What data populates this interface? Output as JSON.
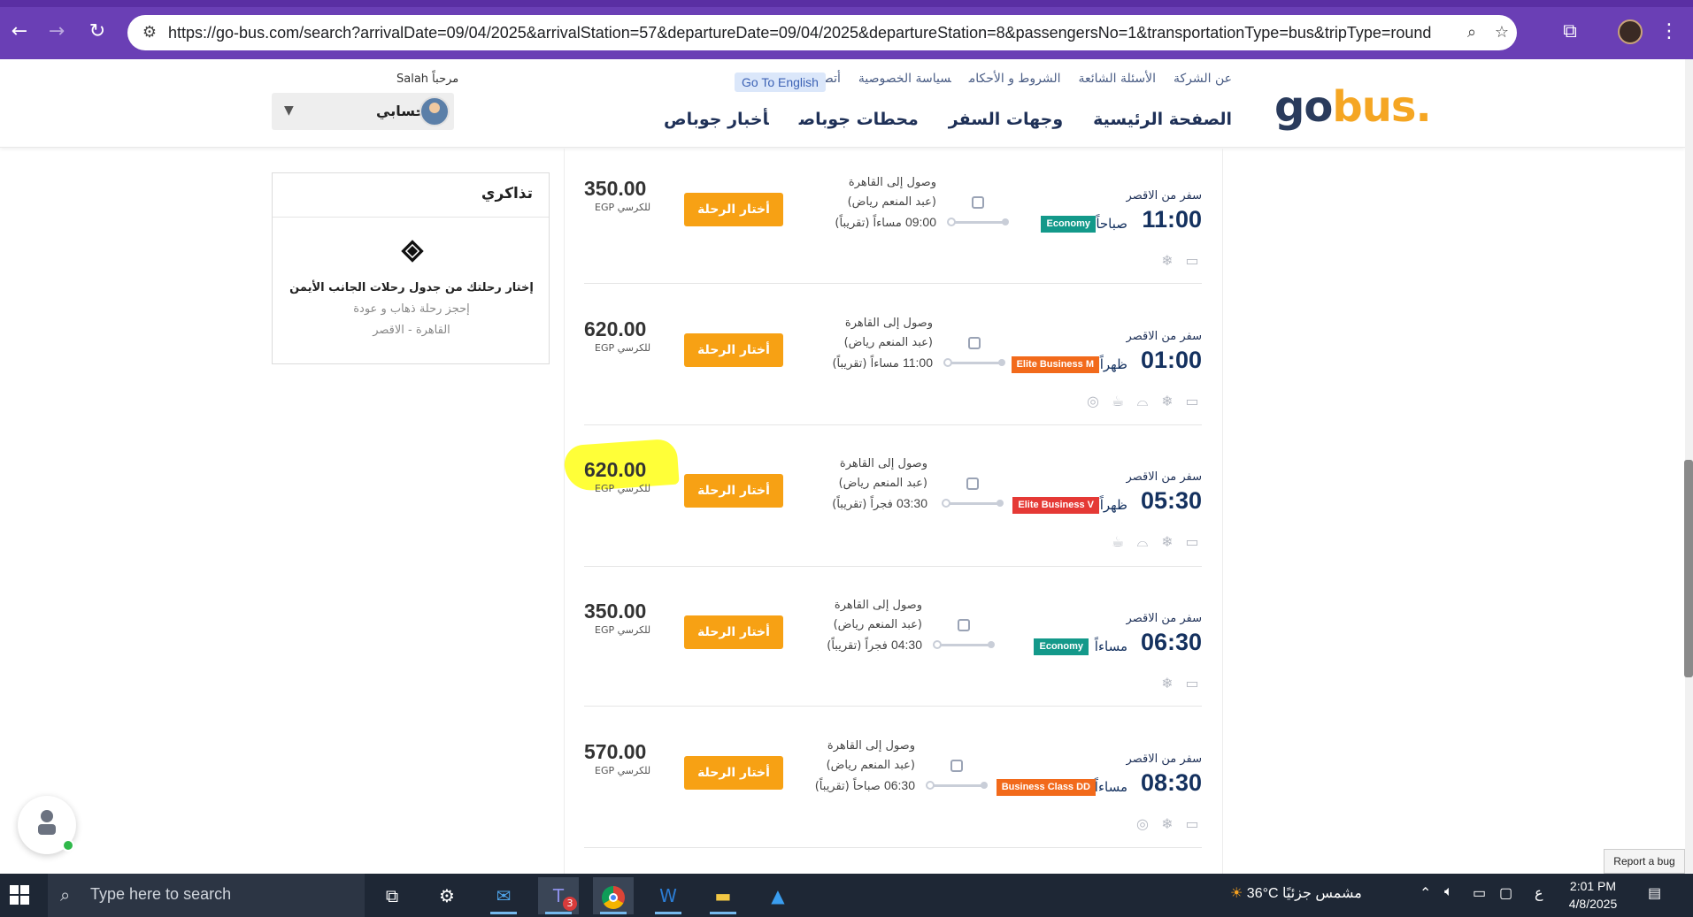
{
  "browser": {
    "url": "https://go-bus.com/search?arrivalDate=09/04/2025&arrivalStation=57&departureDate=09/04/2025&departureStation=8&passengersNo=1&transportationType=bus&tripType=round"
  },
  "header": {
    "logo_go": "go",
    "logo_bus": "bus.",
    "top_links": [
      "عن الشركة",
      "الأسئلة الشائعة",
      "الشروط و الأحكام",
      "سياسة الخصوصية",
      "أتصل بنا"
    ],
    "go_english": "Go To English",
    "main_nav": [
      "الصفحة الرئيسية",
      "وجهات السفر",
      "محطات جوباص",
      "أخبار جوباص"
    ],
    "welcome": "مرحباً Salah",
    "account_label": "حسابي"
  },
  "tickets": {
    "title": "تذاكري",
    "line1": "إختار رحلتك من جدول رحلات الجانب الأيمن",
    "line2": "إحجز رحلة ذهاب و عودة",
    "line3": "القاهرة - الاقصر"
  },
  "trips": [
    {
      "price": "350.00",
      "per_seat": "EGP للكرسي",
      "button": "أختار الرحلة",
      "arrive_1": "وصول إلى القاهرة",
      "arrive_2": "(عبد المنعم رياض)",
      "arrive_time": "09:00",
      "arrive_period": "مساءاً (تقريباً)",
      "from": "سفر من الاقصر",
      "time": "11:00",
      "period": "صباحاً",
      "class": "Economy",
      "class_color": "#13998a",
      "amenities": [
        "tv-icon",
        "snowflake-icon"
      ]
    },
    {
      "price": "620.00",
      "per_seat": "EGP للكرسي",
      "button": "أختار الرحلة",
      "arrive_1": "وصول إلى القاهرة",
      "arrive_2": "(عبد المنعم رياض)",
      "arrive_time": "11:00",
      "arrive_period": "مساءاً (تقريباً)",
      "from": "سفر من الاقصر",
      "time": "01:00",
      "period": "ظهراً",
      "class": "Elite Business M",
      "class_color": "#f26a1b",
      "amenities": [
        "tv-icon",
        "snowflake-icon",
        "meal-icon",
        "coffee-icon",
        "wifi-icon"
      ]
    },
    {
      "price": "620.00",
      "per_seat": "EGP للكرسي",
      "button": "أختار الرحلة",
      "arrive_1": "وصول إلى القاهرة",
      "arrive_2": "(عبد المنعم رياض)",
      "arrive_time": "03:30",
      "arrive_period": "فجراً (تقريباً)",
      "from": "سفر من الاقصر",
      "time": "05:30",
      "period": "ظهراً",
      "class": "Elite Business V",
      "class_color": "#e53935",
      "amenities": [
        "tv-icon",
        "snowflake-icon",
        "meal-icon",
        "coffee-icon"
      ]
    },
    {
      "price": "350.00",
      "per_seat": "EGP للكرسي",
      "button": "أختار الرحلة",
      "arrive_1": "وصول إلى القاهرة",
      "arrive_2": "(عبد المنعم رياض)",
      "arrive_time": "04:30",
      "arrive_period": "فجراً (تقريباً)",
      "from": "سفر من الاقصر",
      "time": "06:30",
      "period": "مساءاً",
      "class": "Economy",
      "class_color": "#13998a",
      "amenities": [
        "tv-icon",
        "snowflake-icon"
      ]
    },
    {
      "price": "570.00",
      "per_seat": "EGP للكرسي",
      "button": "أختار الرحلة",
      "arrive_1": "وصول إلى القاهرة",
      "arrive_2": "(عبد المنعم رياض)",
      "arrive_time": "06:30",
      "arrive_period": "صباحاً (تقريباً)",
      "from": "سفر من الاقصر",
      "time": "08:30",
      "period": "مساءاً",
      "class": "Business Class DD",
      "class_color": "#f26a1b",
      "amenities": [
        "tv-icon",
        "snowflake-icon",
        "wifi-icon"
      ]
    }
  ],
  "report_bug": "Report a bug",
  "taskbar": {
    "search_placeholder": "Type here to search",
    "teams_badge": "3",
    "weather": "36°C  مشمس جزئيًا",
    "lang": "ع",
    "time": "2:01 PM",
    "date": "4/8/2025"
  }
}
